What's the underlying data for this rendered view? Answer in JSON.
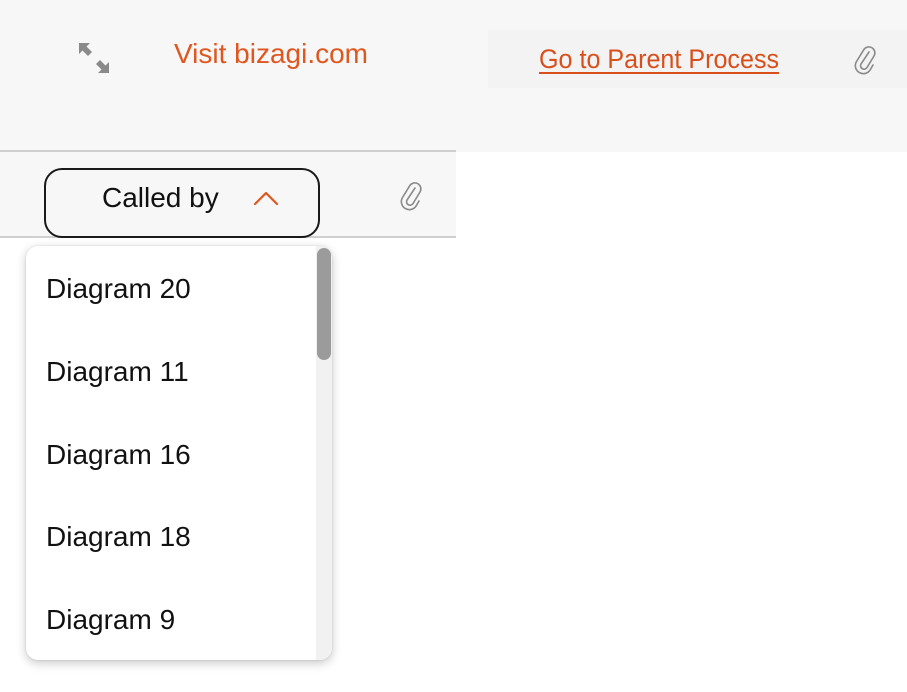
{
  "header": {
    "expand_icon": "expand-arrows-icon",
    "visit_link": "Visit bizagi.com",
    "parent_link": "Go to Parent Process",
    "attachment_icon": "paperclip-icon"
  },
  "called_by": {
    "label": "Called by",
    "toggle_icon": "chevron-up-icon",
    "attachment_icon": "paperclip-icon",
    "expanded": true,
    "items": [
      "Diagram 20",
      "Diagram 11",
      "Diagram 16",
      "Diagram 18",
      "Diagram 9"
    ]
  },
  "colors": {
    "accent": "#e0561f",
    "link": "#d94f1c",
    "text": "#111111",
    "icon_gray": "#8a8a8a"
  }
}
